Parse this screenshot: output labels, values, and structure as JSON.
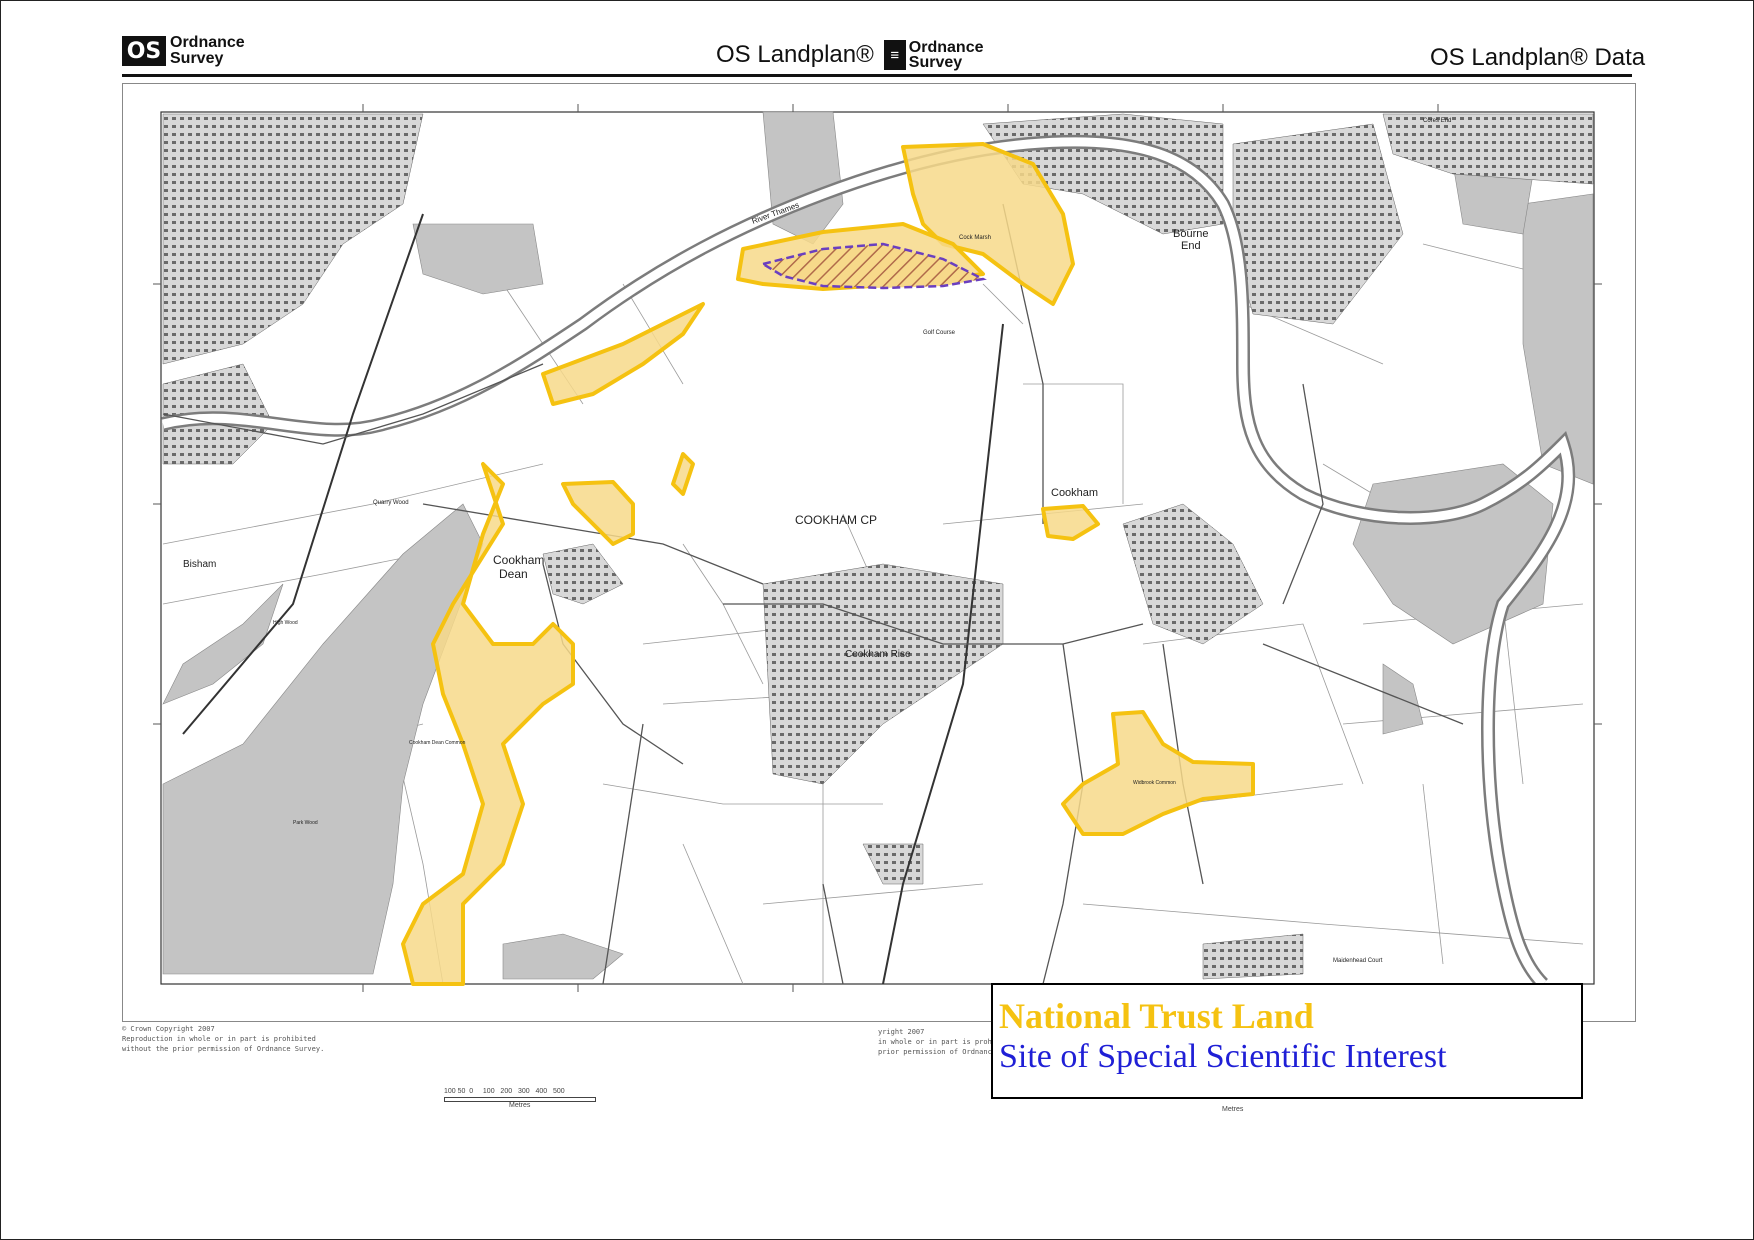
{
  "header": {
    "logo_left_symbol": "OS",
    "logo_left_line1": "Ordnance",
    "logo_left_line2": "Survey",
    "center_title": "OS Landplan®",
    "center_logo_line1": "Ordnance",
    "center_logo_line2": "Survey",
    "right_title": "OS Landplan® Data"
  },
  "map": {
    "place_labels": {
      "cookham_dean_1": "Cookham",
      "cookham_dean_2": "Dean",
      "cookham_cp": "COOKHAM CP",
      "cookham": "Cookham",
      "cookham_rise": "Cookham Rise",
      "bourne_end_1": "Bourne",
      "bourne_end_2": "End",
      "bisham": "Bisham",
      "river_thames": "River Thames",
      "quarry_wood": "Quarry Wood",
      "golf_course": "Golf Course",
      "cock_marsh": "Cock Marsh",
      "cookham_dean_common": "Cookham Dean Common",
      "widbrook_common": "Widbrook Common",
      "maidenhead_court": "Maidenhead Court",
      "cores_end": "Cores End",
      "high_wood": "High Wood",
      "park_wood": "Park Wood"
    },
    "colors": {
      "nt_fill": "#f7d98a",
      "nt_outline": "#f5c211",
      "sssi_outline": "#6a3fc0",
      "woodland": "#bdbdbd",
      "urban": "#8f8f8f"
    }
  },
  "copyright": {
    "left_1": "© Crown Copyright 2007",
    "left_2": "Reproduction in whole or in part is prohibited",
    "left_3": "without the prior permission of Ordnance Survey.",
    "mid_1": "yright 2007",
    "mid_2": "in whole or in part is prohibit",
    "mid_3": "prior permission of Ordnance Su"
  },
  "scalebar": {
    "ticks": "100 50  0     100   200   300   400   500",
    "unit": "Metres",
    "unit_right": "Metres"
  },
  "legend": {
    "national_trust": "National Trust Land",
    "sssi": "Site of Special Scientific Interest",
    "national_trust_color": "#f5c211",
    "sssi_color": "#1f1fd6"
  }
}
